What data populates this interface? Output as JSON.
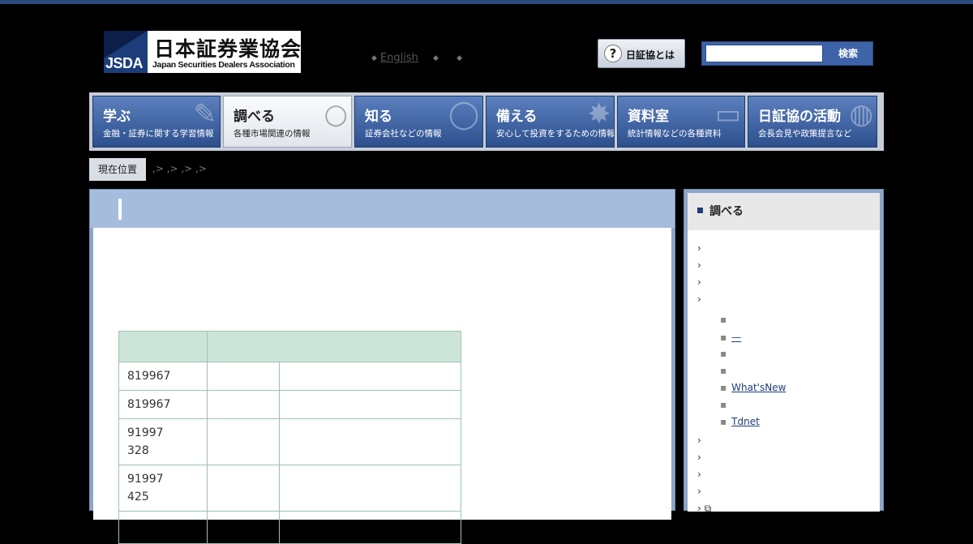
{
  "header": {
    "logo_abbr": "JSDA",
    "logo_name_jp": "日本証券業協会",
    "logo_name_en": "Japan Securities Dealers Association",
    "lang_links": [
      "English",
      "",
      ""
    ],
    "about_label": "日証協とは",
    "search_button": "検索",
    "search_value": ""
  },
  "nav": {
    "tabs": [
      {
        "title": "学ぶ",
        "subtitle": "金融・証券に関する学習情報"
      },
      {
        "title": "調べる",
        "subtitle": "各種市場関連の情報"
      },
      {
        "title": "知る",
        "subtitle": "証券会社などの情報"
      },
      {
        "title": "備える",
        "subtitle": "安心して投資をするための情報"
      },
      {
        "title": "資料室",
        "subtitle": "統計情報などの各種資料"
      },
      {
        "title": "日証協の活動",
        "subtitle": "会長会見や政策提言など"
      }
    ]
  },
  "breadcrumb": {
    "label": "現在位置",
    "trail": ",> ,> ,> ,>"
  },
  "table": {
    "rows": [
      {
        "c1": "819967",
        "c2": "",
        "c3": ""
      },
      {
        "c1": "819967",
        "c2": "",
        "c3": ""
      },
      {
        "c1a": "91997",
        "c1b": "328",
        "c2": "",
        "c3": ""
      },
      {
        "c1a": "91997",
        "c1b": "425",
        "c2": "",
        "c3": ""
      }
    ]
  },
  "sidebar": {
    "title": "調べる",
    "chevron": "›",
    "bullet": "▪",
    "subitems": [
      "",
      "—",
      "",
      "",
      "What'sNew",
      "",
      "Tdnet"
    ]
  }
}
